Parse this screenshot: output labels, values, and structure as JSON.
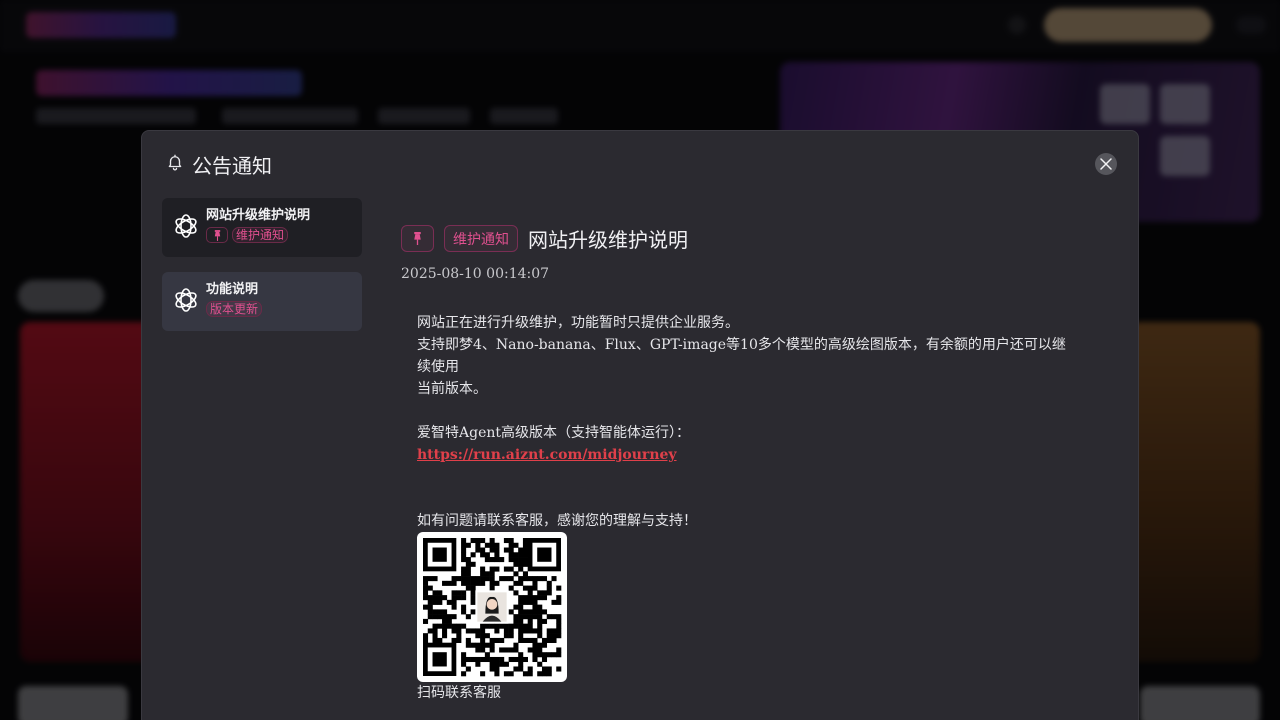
{
  "modal": {
    "title": "公告通知",
    "close_label": "close"
  },
  "notices": [
    {
      "title": "网站升级维护说明",
      "pinned": true,
      "tag": "维护通知"
    },
    {
      "title": "功能说明",
      "pinned": false,
      "tag": "版本更新"
    }
  ],
  "detail": {
    "tag": "维护通知",
    "title": "网站升级维护说明",
    "time": "2025-08-10 00:14:07",
    "line1": "网站正在进行升级维护，功能暂时只提供企业服务。",
    "line2": "支持即梦4、Nano-banana、Flux、GPT-image等10多个模型的高级绘图版本，有余额的用户还可以继续使用",
    "line3": "当前版本。",
    "line4": "爱智特Agent高级版本（支持智能体运行）：",
    "link": "https://run.aiznt.com/midjourney",
    "line5": "如有问题请联系客服，感谢您的理解与支持！",
    "qr_caption": "扫码联系客服"
  },
  "colors": {
    "accent": "#e0508f",
    "link": "#e0404a",
    "modal_bg": "#2b2a30"
  },
  "icons": {
    "header": "bell-icon",
    "close": "close-icon",
    "pin": "pin-icon",
    "notice": "openai-logo-icon"
  }
}
